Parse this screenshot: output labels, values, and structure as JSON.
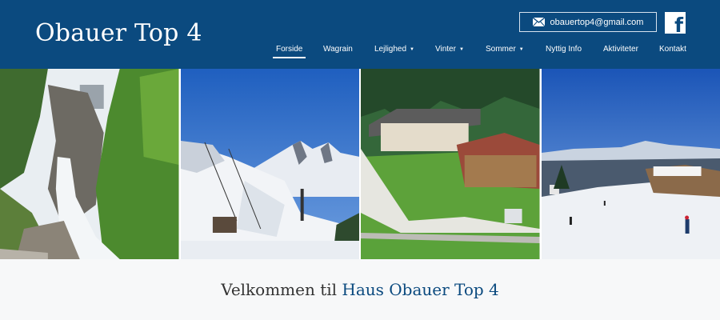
{
  "header": {
    "logo": "Obauer Top 4",
    "email": "obauertop4@gmail.com",
    "email_icon": "envelope-icon",
    "social_icon": "facebook-icon",
    "brand_color": "#0b4a7f"
  },
  "nav": {
    "items": [
      {
        "label": "Forside",
        "active": true,
        "dropdown": false
      },
      {
        "label": "Wagrain",
        "active": false,
        "dropdown": false
      },
      {
        "label": "Lejlighed",
        "active": false,
        "dropdown": true
      },
      {
        "label": "Vinter",
        "active": false,
        "dropdown": true
      },
      {
        "label": "Sommer",
        "active": false,
        "dropdown": true
      },
      {
        "label": "Nyttig Info",
        "active": false,
        "dropdown": false
      },
      {
        "label": "Aktiviteter",
        "active": false,
        "dropdown": false
      },
      {
        "label": "Kontakt",
        "active": false,
        "dropdown": false
      }
    ],
    "caret": "▼"
  },
  "main": {
    "welcome_prefix": "Velkommen til",
    "welcome_highlight": "Haus Obauer Top 4"
  }
}
